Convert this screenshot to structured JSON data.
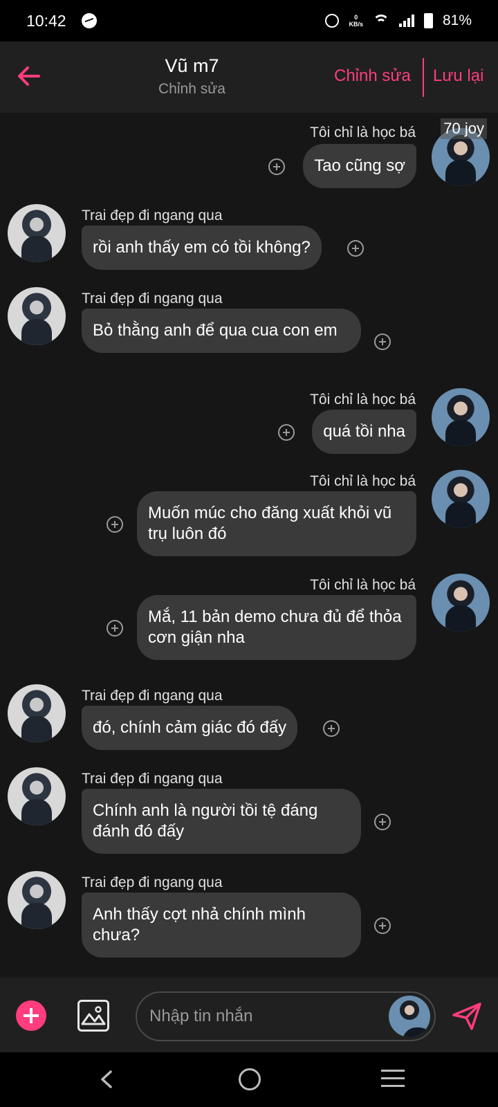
{
  "status_bar": {
    "time": "10:42",
    "net_speed_value": "0",
    "net_speed_unit": "KB/s",
    "battery": "81%"
  },
  "header": {
    "title": "Vũ m7",
    "subtitle": "Chỉnh sửa",
    "edit_label": "Chỉnh sửa",
    "save_label": "Lưu lại"
  },
  "overlay_label": "70 joy",
  "messages": [
    {
      "side": "right",
      "sender": "Tôi chỉ là học bá",
      "text": "Tao cũng sợ"
    },
    {
      "side": "left",
      "sender": "Trai đẹp đi ngang qua",
      "text": "rồi anh thấy em có tồi không?"
    },
    {
      "side": "left",
      "sender": "Trai đẹp đi ngang qua",
      "text": "Bỏ thằng anh để qua cua con em"
    },
    {
      "side": "right",
      "sender": "Tôi chỉ là học bá",
      "text": "quá tồi nha"
    },
    {
      "side": "right",
      "sender": "Tôi chỉ là học bá",
      "text": "Muốn múc cho đăng xuất khỏi vũ trụ luôn đó"
    },
    {
      "side": "right",
      "sender": "Tôi chỉ là học bá",
      "text": "Mắ, 11 bản demo chưa đủ để thỏa cơn giận nha"
    },
    {
      "side": "left",
      "sender": "Trai đẹp đi ngang qua",
      "text": "đó, chính cảm giác đó đấy"
    },
    {
      "side": "left",
      "sender": "Trai đẹp đi ngang qua",
      "text": "Chính anh là người tồi tệ đáng đánh đó đấy"
    },
    {
      "side": "left",
      "sender": "Trai đẹp đi ngang qua",
      "text": "Anh thấy cợt nhả chính mình chưa?"
    }
  ],
  "input": {
    "placeholder": "Nhập tin nhắn"
  },
  "colors": {
    "accent": "#ff3d7f",
    "bubble": "#3a3a3a",
    "background": "#161616",
    "header": "#202020"
  },
  "icons": [
    "back-arrow-icon",
    "add-reaction-icon",
    "add-icon",
    "image-icon",
    "send-icon",
    "nav-back-icon",
    "nav-home-icon",
    "nav-recent-icon"
  ]
}
